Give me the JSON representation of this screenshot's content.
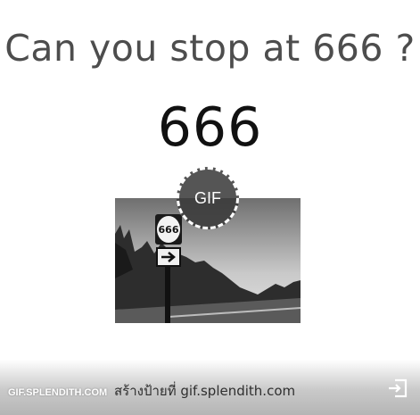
{
  "heading": "Can you stop at 666 ?",
  "counter_value": "666",
  "badge": {
    "label": "GIF"
  },
  "photo": {
    "sign_number": "666",
    "sign_arrow": "right-arrow-icon"
  },
  "footer": {
    "brand": "GIF.SPLENDITH.COM",
    "promo": "สร้างป้ายที่ gif.splendith.com",
    "exit_icon": "exit-icon"
  },
  "colors": {
    "heading": "#4d4d4d",
    "counter": "#111111",
    "badge_bg": "#373737",
    "footer_bg": "#c9c9c9"
  }
}
